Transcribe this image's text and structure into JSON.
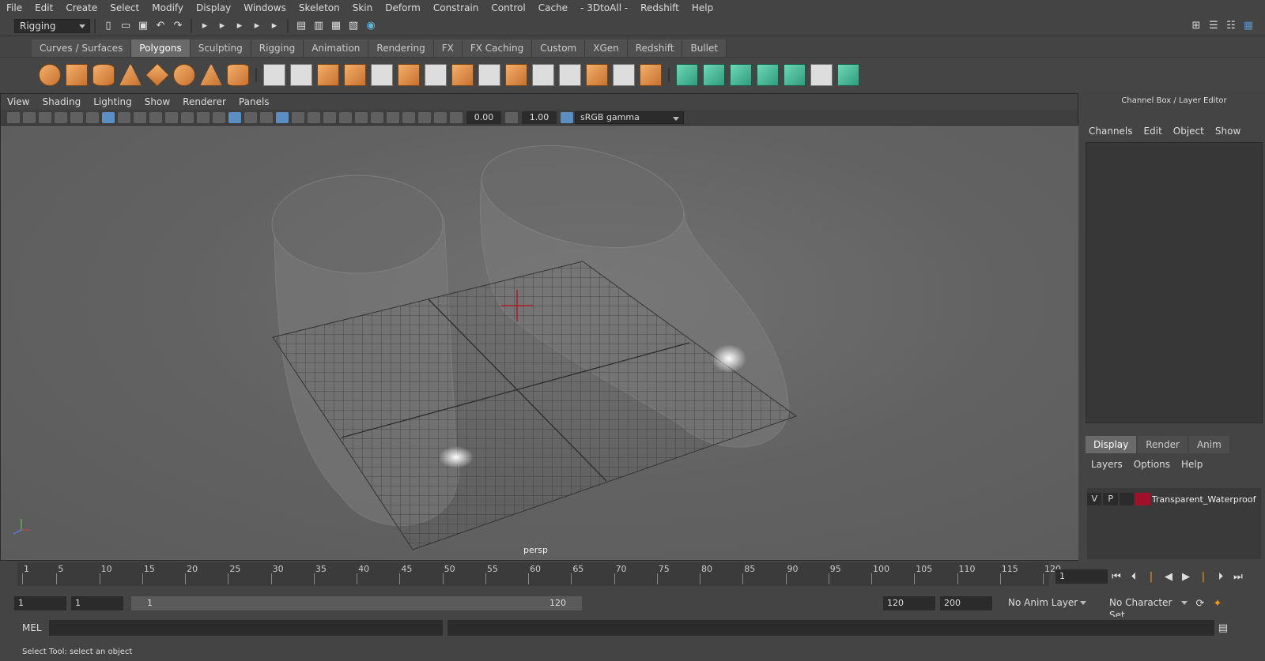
{
  "menubar": {
    "items": [
      "File",
      "Edit",
      "Create",
      "Select",
      "Modify",
      "Display",
      "Windows",
      "Skeleton",
      "Skin",
      "Deform",
      "Constrain",
      "Control",
      "Cache",
      "- 3DtoAll -",
      "Redshift",
      "Help"
    ]
  },
  "status": {
    "mode": "Rigging"
  },
  "shelf": {
    "tabs": [
      "Curves / Surfaces",
      "Polygons",
      "Sculpting",
      "Rigging",
      "Animation",
      "Rendering",
      "FX",
      "FX Caching",
      "Custom",
      "XGen",
      "Redshift",
      "Bullet"
    ],
    "active": "Polygons"
  },
  "viewport": {
    "menu": [
      "View",
      "Shading",
      "Lighting",
      "Show",
      "Renderer",
      "Panels"
    ],
    "exposure": "0.00",
    "gamma": "1.00",
    "colorspace": "sRGB gamma",
    "camera": "persp"
  },
  "channelbox": {
    "title": "Channel Box / Layer Editor",
    "menu": [
      "Channels",
      "Edit",
      "Object",
      "Show"
    ]
  },
  "layereditor": {
    "tabs": [
      "Display",
      "Render",
      "Anim"
    ],
    "active": "Display",
    "menu": [
      "Layers",
      "Options",
      "Help"
    ],
    "layer": {
      "v": "V",
      "p": "P",
      "name": "Transparent_Waterproof",
      "color": "#a0102a"
    }
  },
  "timeline": {
    "ticks": [
      "1",
      "5",
      "10",
      "15",
      "20",
      "25",
      "30",
      "35",
      "40",
      "45",
      "50",
      "55",
      "60",
      "65",
      "70",
      "75",
      "80",
      "85",
      "90",
      "95",
      "100",
      "105",
      "110",
      "115",
      "120"
    ],
    "current": "1"
  },
  "range": {
    "start": "1",
    "playstart": "1",
    "slider_start": "1",
    "slider_end": "120",
    "end": "120",
    "maxend": "200",
    "animlayer": "No Anim Layer",
    "charset": "No Character Set"
  },
  "cmd": {
    "lang": "MEL"
  },
  "help": {
    "text": "Select Tool: select an object"
  }
}
